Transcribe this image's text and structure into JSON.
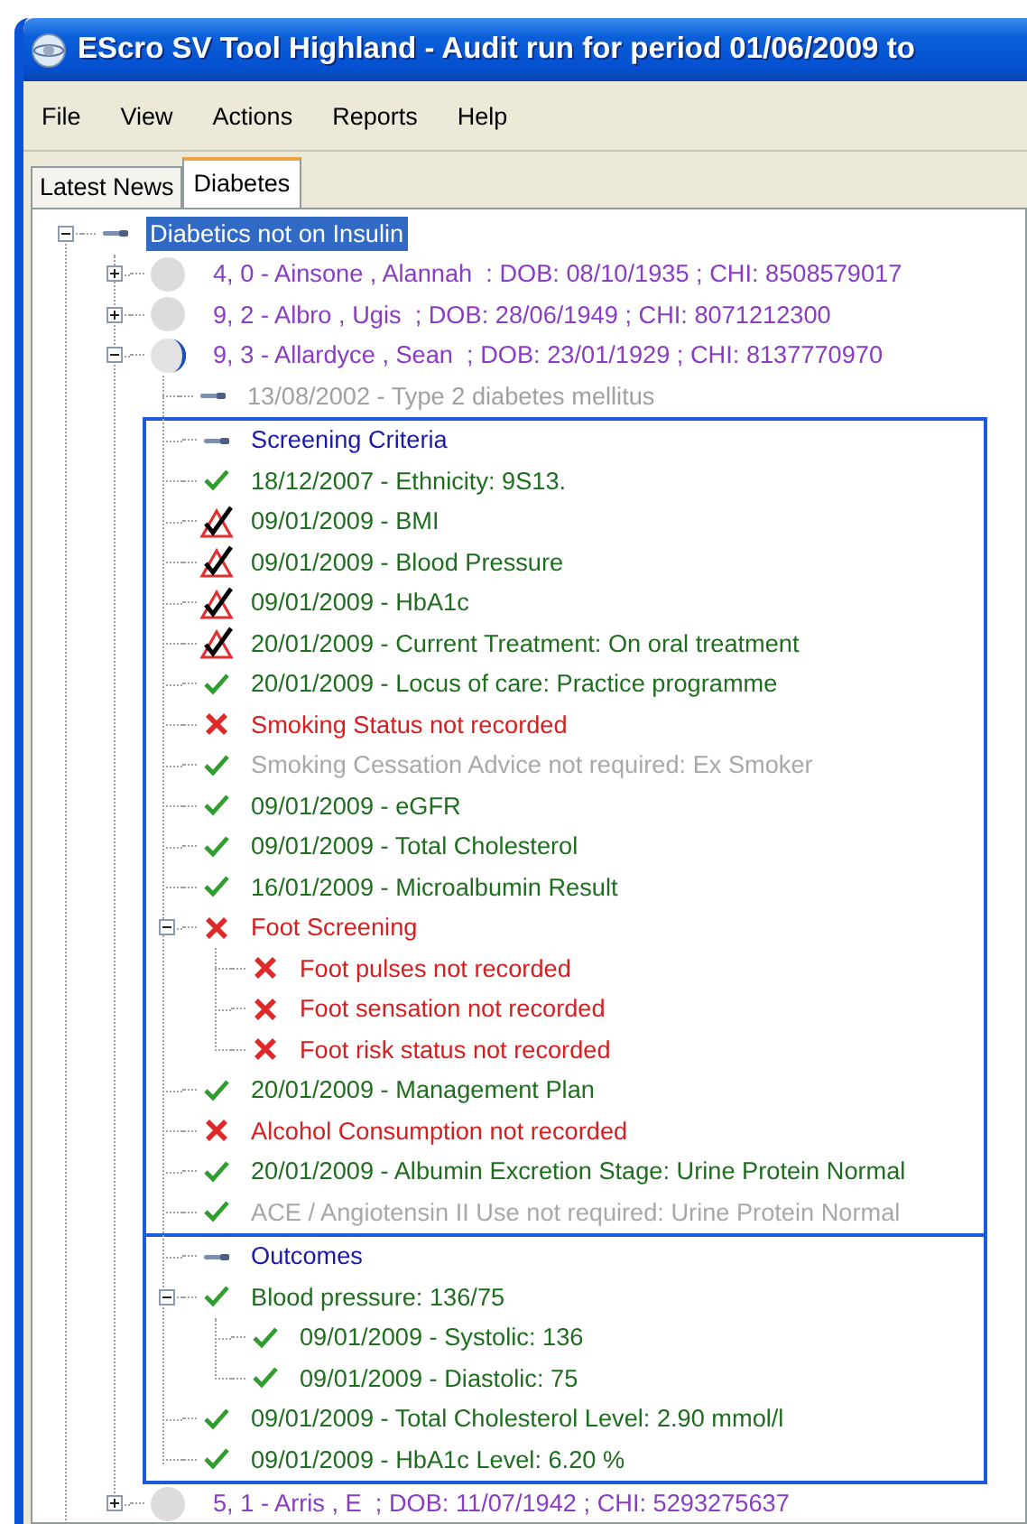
{
  "window": {
    "title": "EScro SV Tool Highland - Audit run for period 01/06/2009 to"
  },
  "menu": [
    "File",
    "View",
    "Actions",
    "Reports",
    "Help"
  ],
  "tabs": [
    {
      "label": "Latest News",
      "selected": false
    },
    {
      "label": "Diabetes",
      "selected": true
    }
  ],
  "tree": [
    {
      "label": "Diabetics not on Insulin",
      "kind": "group",
      "selected": true,
      "expanded": true,
      "children": [
        {
          "label": "4, 0 - Ainsone , Alannah  : DOB: 08/10/1935 ; CHI: 8508579017",
          "kind": "patient",
          "selected": false,
          "expanded": false
        },
        {
          "label": "9, 2 - Albro , Ugis  ; DOB: 28/06/1949 ; CHI: 8071212300",
          "kind": "patient",
          "selected": false,
          "expanded": false
        },
        {
          "label": "9, 3 - Allardyce , Sean  ; DOB: 23/01/1929 ; CHI: 8137770970",
          "kind": "partial",
          "selected": false,
          "expanded": true,
          "children": [
            {
              "label": "13/08/2002 - Type 2 diabetes mellitus",
              "kind": "history",
              "selected": false
            },
            {
              "kind": "section",
              "children": [
                {
                  "label": "Screening Criteria",
                  "kind": "group",
                  "selected": false
                },
                {
                  "label": "18/12/2007 - Ethnicity: 9S13.",
                  "kind": "met",
                  "selected": false
                },
                {
                  "label": "09/01/2009 - BMI",
                  "kind": "flagged",
                  "selected": false
                },
                {
                  "label": "09/01/2009 - Blood Pressure",
                  "kind": "flagged",
                  "selected": false
                },
                {
                  "label": "09/01/2009 - HbA1c",
                  "kind": "flagged",
                  "selected": false
                },
                {
                  "label": "20/01/2009 - Current Treatment: On oral treatment",
                  "kind": "flagged",
                  "selected": false
                },
                {
                  "label": "20/01/2009 - Locus of care: Practice programme",
                  "kind": "met",
                  "selected": false
                },
                {
                  "label": "Smoking Status not recorded",
                  "kind": "unmet",
                  "selected": false
                },
                {
                  "label": "Smoking Cessation Advice not required: Ex Smoker",
                  "kind": "exempt",
                  "selected": false
                },
                {
                  "label": "09/01/2009 - eGFR",
                  "kind": "met",
                  "selected": false
                },
                {
                  "label": "09/01/2009 - Total Cholesterol",
                  "kind": "met",
                  "selected": false
                },
                {
                  "label": "16/01/2009 - Microalbumin Result",
                  "kind": "met",
                  "selected": false
                },
                {
                  "label": "Foot Screening",
                  "kind": "unmet",
                  "selected": false,
                  "expanded": true,
                  "children": [
                    {
                      "label": "Foot pulses not recorded",
                      "kind": "unmet",
                      "selected": false
                    },
                    {
                      "label": "Foot sensation not recorded",
                      "kind": "unmet",
                      "selected": false
                    },
                    {
                      "label": "Foot risk status not recorded",
                      "kind": "unmet",
                      "selected": false
                    }
                  ]
                },
                {
                  "label": "20/01/2009 - Management Plan",
                  "kind": "met",
                  "selected": false
                },
                {
                  "label": "Alcohol Consumption not recorded",
                  "kind": "unmet",
                  "selected": false
                },
                {
                  "label": "20/01/2009 - Albumin Excretion Stage: Urine Protein Normal",
                  "kind": "met",
                  "selected": false
                },
                {
                  "label": "ACE / Angiotensin II Use not required: Urine Protein Normal",
                  "kind": "exempt",
                  "selected": false
                }
              ]
            },
            {
              "kind": "section",
              "children": [
                {
                  "label": "Outcomes",
                  "kind": "group",
                  "selected": false
                },
                {
                  "label": "Blood pressure: 136/75",
                  "kind": "met",
                  "selected": false,
                  "expanded": true,
                  "children": [
                    {
                      "label": "09/01/2009 - Systolic: 136",
                      "kind": "met",
                      "selected": false
                    },
                    {
                      "label": "09/01/2009 - Diastolic: 75",
                      "kind": "met",
                      "selected": false
                    }
                  ]
                },
                {
                  "label": "09/01/2009 - Total Cholesterol Level: 2.90 mmol/l",
                  "kind": "met",
                  "selected": false
                },
                {
                  "label": "09/01/2009 - HbA1c Level: 6.20 %",
                  "kind": "met",
                  "selected": false
                }
              ]
            }
          ]
        },
        {
          "label": "5, 1 - Arris , E  ; DOB: 11/07/1942 ; CHI: 5293275637",
          "kind": "patient",
          "selected": false,
          "expanded": false
        }
      ]
    }
  ]
}
